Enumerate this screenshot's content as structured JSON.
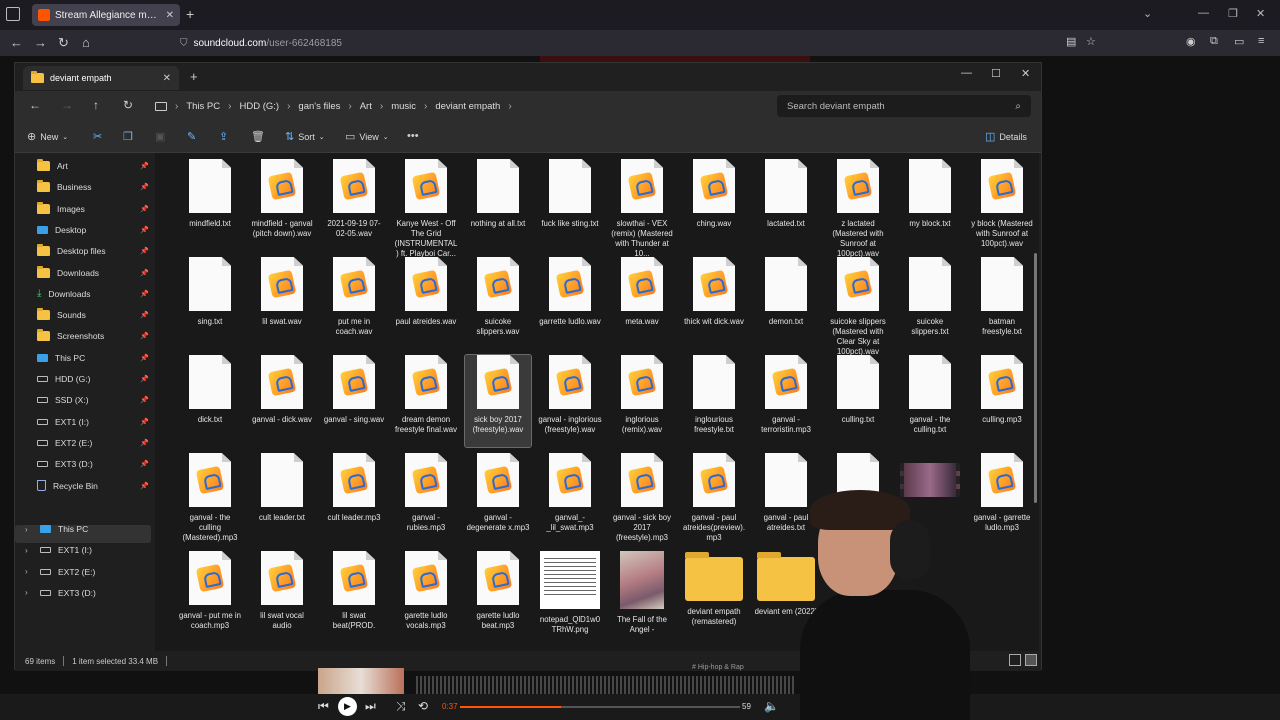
{
  "browser": {
    "tab_title": "Stream Allegiance music | Liste",
    "url_host": "soundcloud.com",
    "url_path": "/user-662468185"
  },
  "explorer": {
    "tab_title": "deviant empath",
    "breadcrumbs": [
      "This PC",
      "HDD (G:)",
      "gan's files",
      "Art",
      "music",
      "deviant empath"
    ],
    "search_placeholder": "Search deviant empath",
    "commands": {
      "new": "New",
      "sort": "Sort",
      "view": "View",
      "details": "Details"
    },
    "sidebar": {
      "quick_access": [
        {
          "label": "Art",
          "icon": "folder-icon"
        },
        {
          "label": "Business",
          "icon": "folder-icon"
        },
        {
          "label": "Images",
          "icon": "folder-icon"
        },
        {
          "label": "Desktop",
          "icon": "desktop-icon"
        },
        {
          "label": "Desktop files",
          "icon": "folder-icon"
        },
        {
          "label": "Downloads",
          "icon": "folder-icon"
        },
        {
          "label": "Downloads",
          "icon": "download-icon"
        },
        {
          "label": "Sounds",
          "icon": "folder-icon"
        },
        {
          "label": "Screenshots",
          "icon": "folder-icon"
        },
        {
          "label": "This PC",
          "icon": "pc-icon"
        },
        {
          "label": "HDD (G:)",
          "icon": "drive-icon"
        },
        {
          "label": "SSD (X:)",
          "icon": "drive-icon"
        },
        {
          "label": "EXT1 (I:)",
          "icon": "drive-icon"
        },
        {
          "label": "EXT2 (E:)",
          "icon": "drive-icon"
        },
        {
          "label": "EXT3 (D:)",
          "icon": "drive-icon"
        },
        {
          "label": "Recycle Bin",
          "icon": "recycle-bin-icon"
        }
      ],
      "tree": [
        {
          "label": "This PC",
          "icon": "pc-icon"
        },
        {
          "label": "EXT1 (I:)",
          "icon": "drive-icon"
        },
        {
          "label": "EXT2 (E:)",
          "icon": "drive-icon"
        },
        {
          "label": "EXT3 (D:)",
          "icon": "drive-icon"
        }
      ]
    },
    "files": [
      {
        "name": "mindfield.txt",
        "type": "txt"
      },
      {
        "name": "mindfield - ganval (pitch down).wav",
        "type": "audio"
      },
      {
        "name": "2021-09-19 07-02-05.wav",
        "type": "audio"
      },
      {
        "name": "Kanye West - Off The Grid (INSTRUMENTAL) ft. Playboi Car...",
        "type": "audio"
      },
      {
        "name": "nothing at all.txt",
        "type": "txt"
      },
      {
        "name": "fuck like sting.txt",
        "type": "txt"
      },
      {
        "name": "slowthai - VEX (remix) (Mastered with Thunder at 10...",
        "type": "audio"
      },
      {
        "name": "ching.wav",
        "type": "audio"
      },
      {
        "name": "lactated.txt",
        "type": "txt"
      },
      {
        "name": "z lactated (Mastered with Sunroof at 100pct).wav",
        "type": "audio"
      },
      {
        "name": "my block.txt",
        "type": "txt"
      },
      {
        "name": "y block (Mastered with Sunroof at 100pct).wav",
        "type": "audio"
      },
      {
        "name": "sing.txt",
        "type": "txt"
      },
      {
        "name": "lil swat.wav",
        "type": "audio"
      },
      {
        "name": "put me in coach.wav",
        "type": "audio"
      },
      {
        "name": "paul atreides.wav",
        "type": "audio"
      },
      {
        "name": "suicoke slippers.wav",
        "type": "audio"
      },
      {
        "name": "garrette ludlo.wav",
        "type": "audio"
      },
      {
        "name": "meta.wav",
        "type": "audio"
      },
      {
        "name": "thick wit dick.wav",
        "type": "audio"
      },
      {
        "name": "demon.txt",
        "type": "txt"
      },
      {
        "name": "suicoke slippers (Mastered with Clear Sky at 100pct).wav",
        "type": "audio"
      },
      {
        "name": "suicoke slippers.txt",
        "type": "txt"
      },
      {
        "name": "batman freestyle.txt",
        "type": "txt"
      },
      {
        "name": "dick.txt",
        "type": "txt"
      },
      {
        "name": "ganval - dick.wav",
        "type": "audio"
      },
      {
        "name": "ganval - sing.wav",
        "type": "audio"
      },
      {
        "name": "dream demon freestyle final.wav",
        "type": "audio"
      },
      {
        "name": "sick boy 2017 (freestyle).wav",
        "type": "audio",
        "selected": true
      },
      {
        "name": "ganval - inglorious (freestyle).wav",
        "type": "audio"
      },
      {
        "name": "inglorious (remix).wav",
        "type": "audio"
      },
      {
        "name": "inglourious freestyle.txt",
        "type": "txt"
      },
      {
        "name": "ganval - terroristin.mp3",
        "type": "audio"
      },
      {
        "name": "culling.txt",
        "type": "txt"
      },
      {
        "name": "ganval - the culling.txt",
        "type": "txt"
      },
      {
        "name": "culling.mp3",
        "type": "audio"
      },
      {
        "name": "ganval - the culling (Mastered).mp3",
        "type": "audio"
      },
      {
        "name": "cult leader.txt",
        "type": "txt"
      },
      {
        "name": "cult leader.mp3",
        "type": "audio"
      },
      {
        "name": "ganval - rubies.mp3",
        "type": "audio"
      },
      {
        "name": "ganval - degenerate x.mp3",
        "type": "audio"
      },
      {
        "name": "ganval_-_lil_swat.mp3",
        "type": "audio"
      },
      {
        "name": "ganval - sick boy 2017 (freestyle).mp3",
        "type": "audio"
      },
      {
        "name": "ganval - paul atreides(preview).mp3",
        "type": "audio"
      },
      {
        "name": "ganval - paul atreides.txt",
        "type": "txt"
      },
      {
        "name": "",
        "type": "txt"
      },
      {
        "name": "",
        "type": "video"
      },
      {
        "name": "ganval - garrette ludlo.mp3",
        "type": "audio"
      },
      {
        "name": "ganval - put me in coach.mp3",
        "type": "audio"
      },
      {
        "name": "lil swat vocal audio",
        "type": "audio"
      },
      {
        "name": "lil swat beat(PROD.",
        "type": "audio"
      },
      {
        "name": "garette ludlo vocals.mp3",
        "type": "audio"
      },
      {
        "name": "garette ludlo beat.mp3",
        "type": "audio"
      },
      {
        "name": "notepad_QlD1w0TRhW.png",
        "type": "image-doc"
      },
      {
        "name": "The Fall of the Angel -",
        "type": "image-photo"
      },
      {
        "name": "deviant empath (remastered)",
        "type": "folder"
      },
      {
        "name": "deviant em (2022)",
        "type": "folder"
      }
    ],
    "status": {
      "count": "69 items",
      "selection": "1 item selected  33.4 MB"
    }
  },
  "player": {
    "elapsed": "0:37",
    "duration": "59",
    "progress": 0.36,
    "track_tag": "# Hip-hop & Rap"
  }
}
